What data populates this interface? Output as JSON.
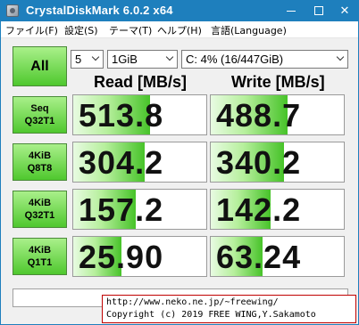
{
  "window": {
    "title": "CrystalDiskMark 6.0.2 x64",
    "min_label": "—",
    "close_label": "✕"
  },
  "menu": {
    "items": [
      "ファイル(F)",
      "設定(S)",
      "テーマ(T)",
      "ヘルプ(H)",
      "言語(Language)"
    ]
  },
  "controls": {
    "all_label": "All",
    "count": "5",
    "size": "1GiB",
    "drive": "C: 4% (16/447GiB)"
  },
  "columns": {
    "read": "Read [MB/s]",
    "write": "Write [MB/s]"
  },
  "rows": [
    {
      "line1": "Seq",
      "line2": "Q32T1",
      "read": "513.8",
      "write": "488.7",
      "read_fill_pct": 58,
      "write_fill_pct": 58
    },
    {
      "line1": "4KiB",
      "line2": "Q8T8",
      "read": "304.2",
      "write": "340.2",
      "read_fill_pct": 54,
      "write_fill_pct": 55
    },
    {
      "line1": "4KiB",
      "line2": "Q32T1",
      "read": "157.2",
      "write": "142.2",
      "read_fill_pct": 47,
      "write_fill_pct": 45
    },
    {
      "line1": "4KiB",
      "line2": "Q1T1",
      "read": "25.90",
      "write": "63.24",
      "read_fill_pct": 36,
      "write_fill_pct": 39
    }
  ],
  "footer": {
    "url": "http://www.neko.ne.jp/~freewing/",
    "copyright": "Copyright (c) 2019 FREE WING,Y.Sakamoto"
  },
  "colors": {
    "titlebar": "#1e7fbd",
    "accent_green": "#47c329",
    "copyright_border": "#c00000"
  }
}
